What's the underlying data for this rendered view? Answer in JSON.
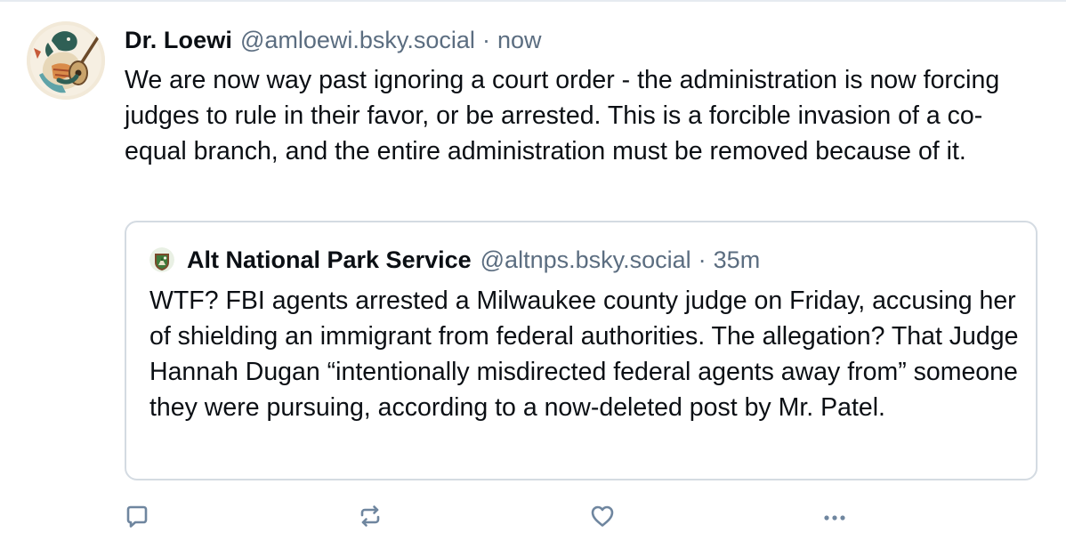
{
  "post": {
    "author_name": "Dr. Loewi",
    "handle": "@amloewi.bsky.social",
    "separator": "·",
    "timestamp": "now",
    "text": "We are now way past ignoring a court order - the administration is now forcing judges to rule in their favor, or be arrested. This is a forcible invasion of a co-equal branch, and the entire administration must be removed because of it."
  },
  "quote": {
    "author_name": "Alt National Park Service",
    "handle": "@altnps.bsky.social",
    "separator": "·",
    "timestamp": "35m",
    "text": "WTF? FBI agents arrested a Milwaukee county judge on Friday, accusing her of shielding an immigrant from federal authorities. The allegation? That Judge Hannah Dugan “intentionally misdirected federal agents away from” someone they were pursuing, according to a now-deleted post by Mr. Patel."
  },
  "actions": {
    "reply_icon": "reply-icon",
    "repost_icon": "repost-icon",
    "like_icon": "heart-icon",
    "more_icon": "more-horizontal-icon"
  },
  "colors": {
    "text": "#0b0f14",
    "muted": "#5b6d80",
    "border": "#d4dbe2",
    "icon": "#6f869f"
  }
}
